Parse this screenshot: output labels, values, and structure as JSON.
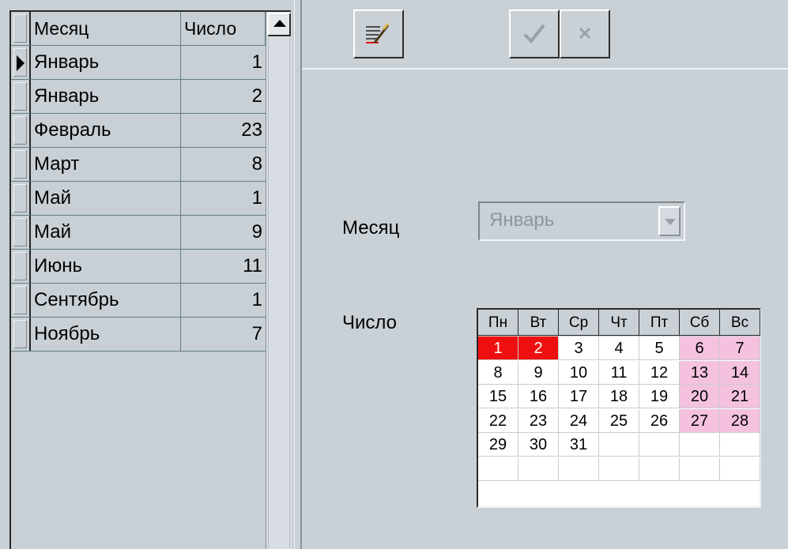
{
  "grid": {
    "columns": {
      "month": "Месяц",
      "number": "Число"
    },
    "rows": [
      {
        "month": "Январь",
        "number": "1"
      },
      {
        "month": "Январь",
        "number": "2"
      },
      {
        "month": "Февраль",
        "number": "23"
      },
      {
        "month": "Март",
        "number": "8"
      },
      {
        "month": "Май",
        "number": "1"
      },
      {
        "month": "Май",
        "number": "9"
      },
      {
        "month": "Июнь",
        "number": "11"
      },
      {
        "month": "Сентябрь",
        "number": "1"
      },
      {
        "month": "Ноябрь",
        "number": "7"
      }
    ],
    "current_row_index": 0
  },
  "toolbar": {
    "edit_icon": "edit-notes-icon",
    "ok_icon": "checkmark-icon",
    "cancel_icon": "cross-icon"
  },
  "form": {
    "month_label": "Месяц",
    "month_value": "Январь",
    "day_label": "Число"
  },
  "calendar": {
    "weekdays": [
      "Пн",
      "Вт",
      "Ср",
      "Чт",
      "Пт",
      "Сб",
      "Вс"
    ],
    "weeks": [
      [
        "1",
        "2",
        "3",
        "4",
        "5",
        "6",
        "7"
      ],
      [
        "8",
        "9",
        "10",
        "11",
        "12",
        "13",
        "14"
      ],
      [
        "15",
        "16",
        "17",
        "18",
        "19",
        "20",
        "21"
      ],
      [
        "22",
        "23",
        "24",
        "25",
        "26",
        "27",
        "28"
      ],
      [
        "29",
        "30",
        "31",
        "",
        "",
        "",
        ""
      ],
      [
        "",
        "",
        "",
        "",
        "",
        "",
        ""
      ]
    ],
    "highlighted_days": [
      "1",
      "2"
    ],
    "colors": {
      "weekend": "#f4c2df",
      "highlight": "#ee1010"
    }
  }
}
